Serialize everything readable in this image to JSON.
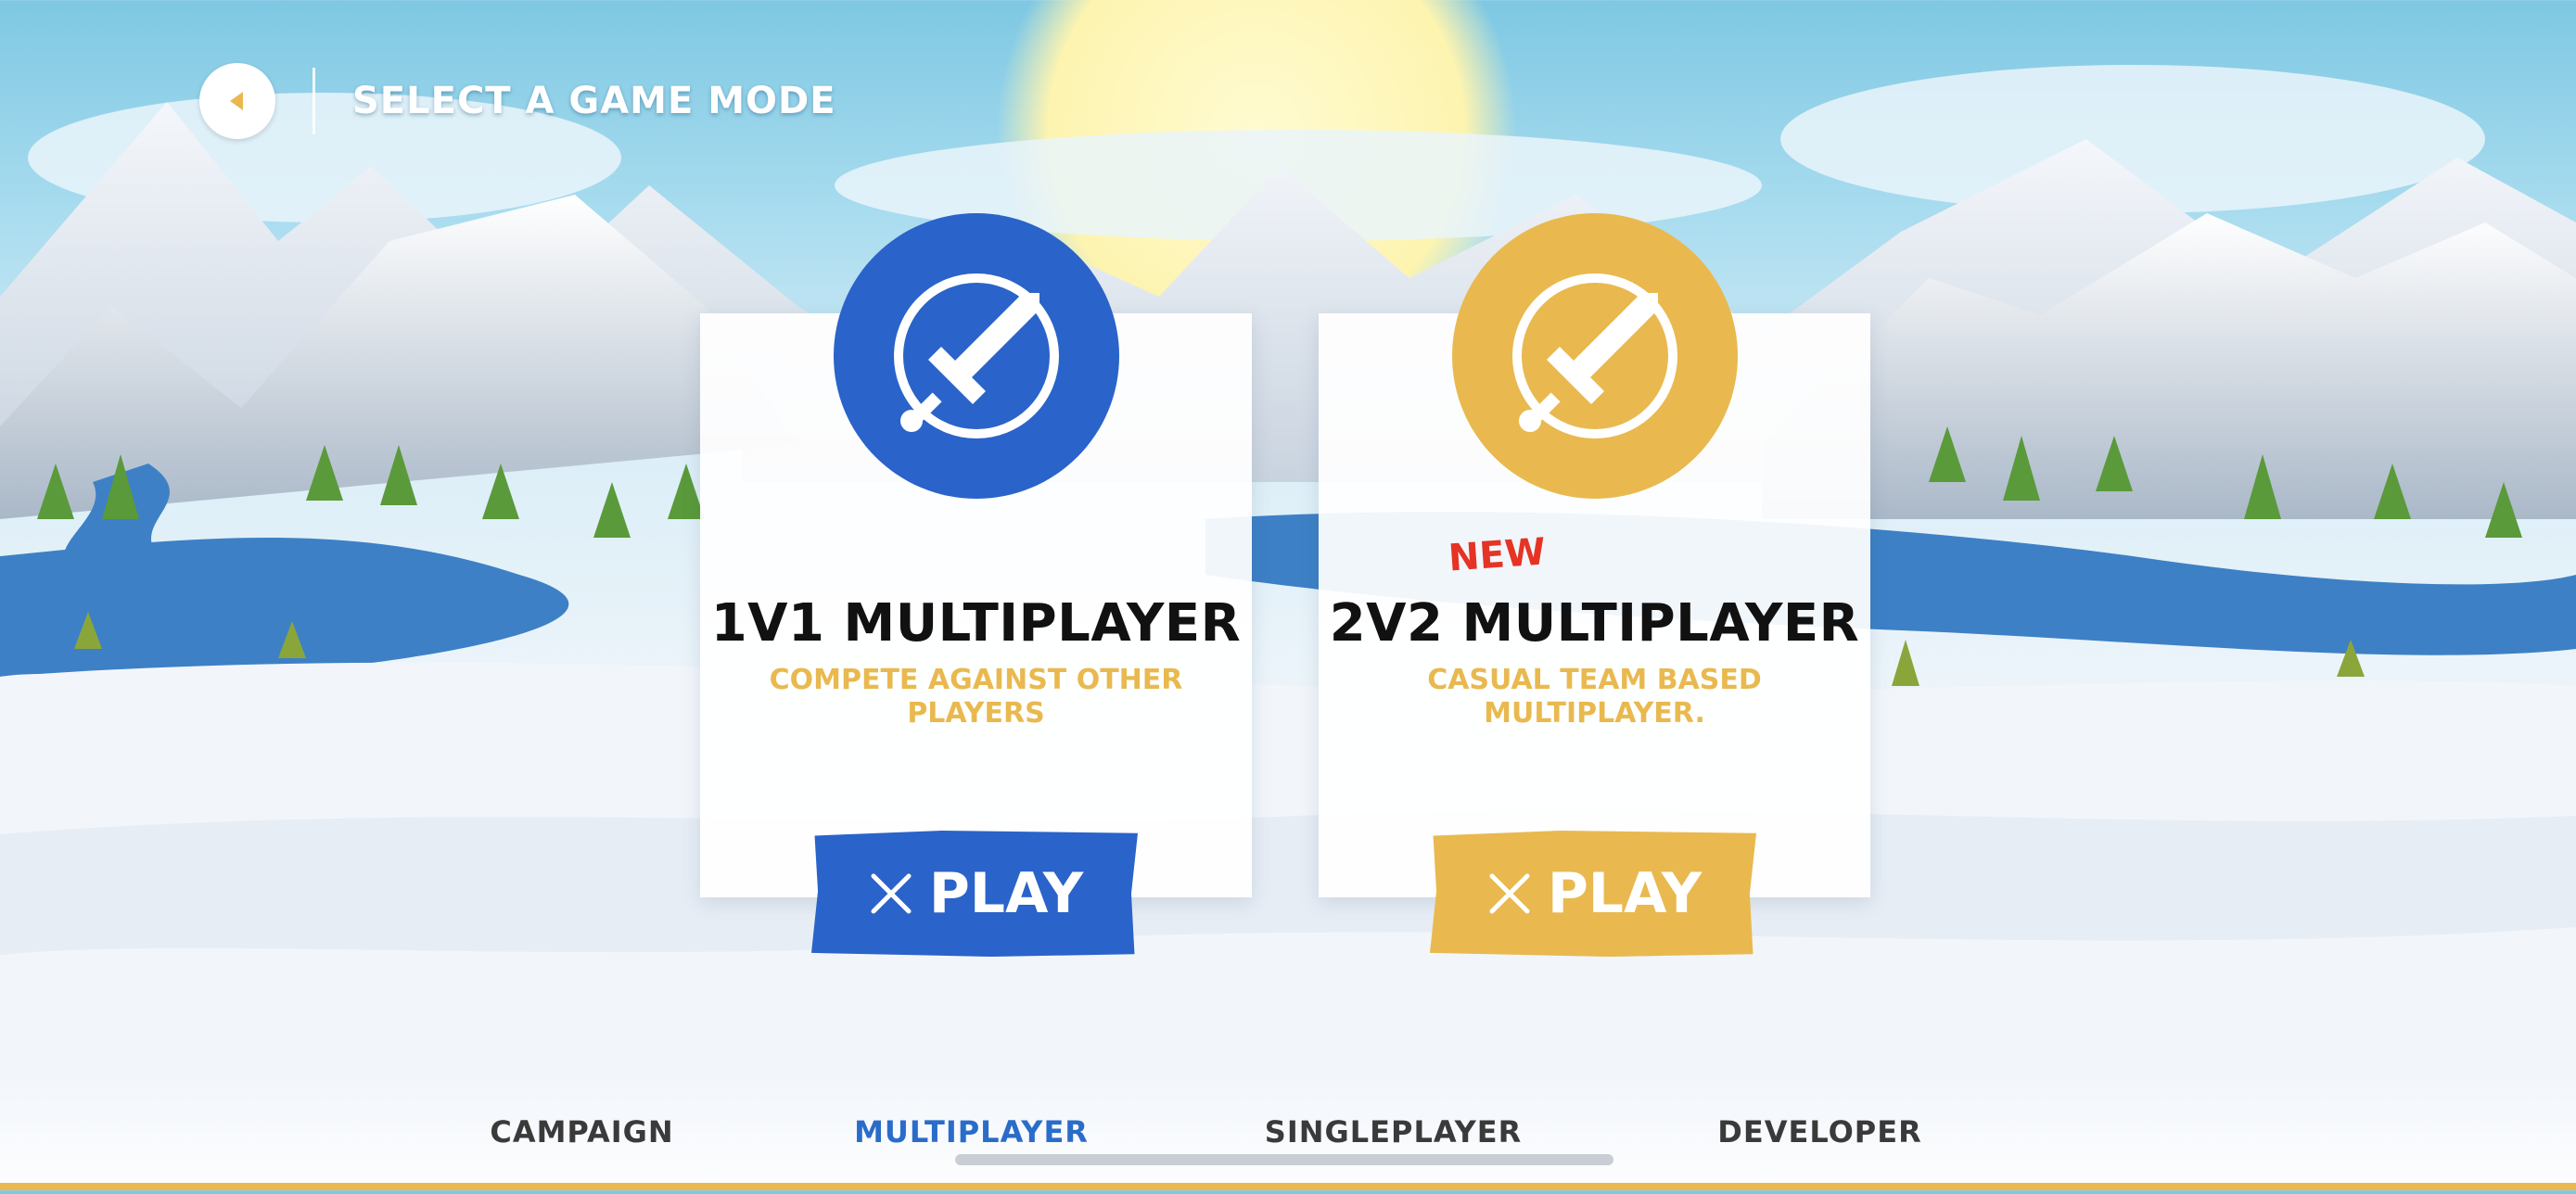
{
  "header": {
    "back_icon": "back-arrow-icon",
    "title": "SELECT A GAME MODE"
  },
  "modes": [
    {
      "title": "1V1 MULTIPLAYER",
      "description": "COMPETE AGAINST OTHER PLAYERS",
      "icon": "sword-icon",
      "color": "#2a63c9",
      "play_label": "PLAY",
      "badge": ""
    },
    {
      "title": "2V2 MULTIPLAYER",
      "description": "CASUAL TEAM BASED MULTIPLAYER.",
      "icon": "sword-icon",
      "color": "#e9b94f",
      "play_label": "PLAY",
      "badge": "NEW"
    }
  ],
  "tabs": [
    {
      "label": "CAMPAIGN",
      "active": false
    },
    {
      "label": "MULTIPLAYER",
      "active": true
    },
    {
      "label": "SINGLEPLAYER",
      "active": false
    },
    {
      "label": "DEVELOPER",
      "active": false
    }
  ],
  "colors": {
    "accent_blue": "#2a63c9",
    "accent_gold": "#e9b94f",
    "new_red": "#e53324",
    "sky": "#7ec8e3"
  }
}
